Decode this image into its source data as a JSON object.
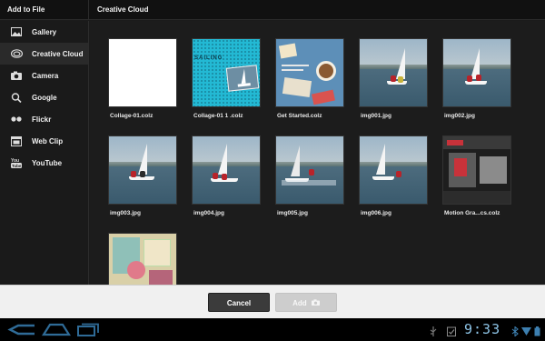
{
  "header": {
    "left_title": "Add to File",
    "right_title": "Creative Cloud"
  },
  "sidebar": {
    "items": [
      {
        "label": "Gallery",
        "icon": "image-icon"
      },
      {
        "label": "Creative Cloud",
        "icon": "creative-cloud-icon",
        "active": true
      },
      {
        "label": "Camera",
        "icon": "camera-icon"
      },
      {
        "label": "Google",
        "icon": "google-search-icon"
      },
      {
        "label": "Flickr",
        "icon": "flickr-icon"
      },
      {
        "label": "Web Clip",
        "icon": "web-clip-icon"
      },
      {
        "label": "YouTube",
        "icon": "youtube-icon"
      }
    ]
  },
  "files": [
    {
      "name": "Collage-01.colz"
    },
    {
      "name": "Collage-01 1 .colz"
    },
    {
      "name": "Get Started.colz"
    },
    {
      "name": "img001.jpg"
    },
    {
      "name": "img002.jpg"
    },
    {
      "name": "img003.jpg"
    },
    {
      "name": "img004.jpg"
    },
    {
      "name": "img005.jpg"
    },
    {
      "name": "img006.jpg"
    },
    {
      "name": "Motion Gra...cs.colz"
    },
    {
      "name": ""
    }
  ],
  "actions": {
    "cancel_label": "Cancel",
    "add_label": "Add"
  },
  "system_bar": {
    "time": "9:33"
  },
  "colors": {
    "clock": "#8ec5e8",
    "action_bar_bg": "#f0f0f0",
    "cancel_bg": "#3b3b3b",
    "add_disabled_bg": "#cdcdcd"
  }
}
